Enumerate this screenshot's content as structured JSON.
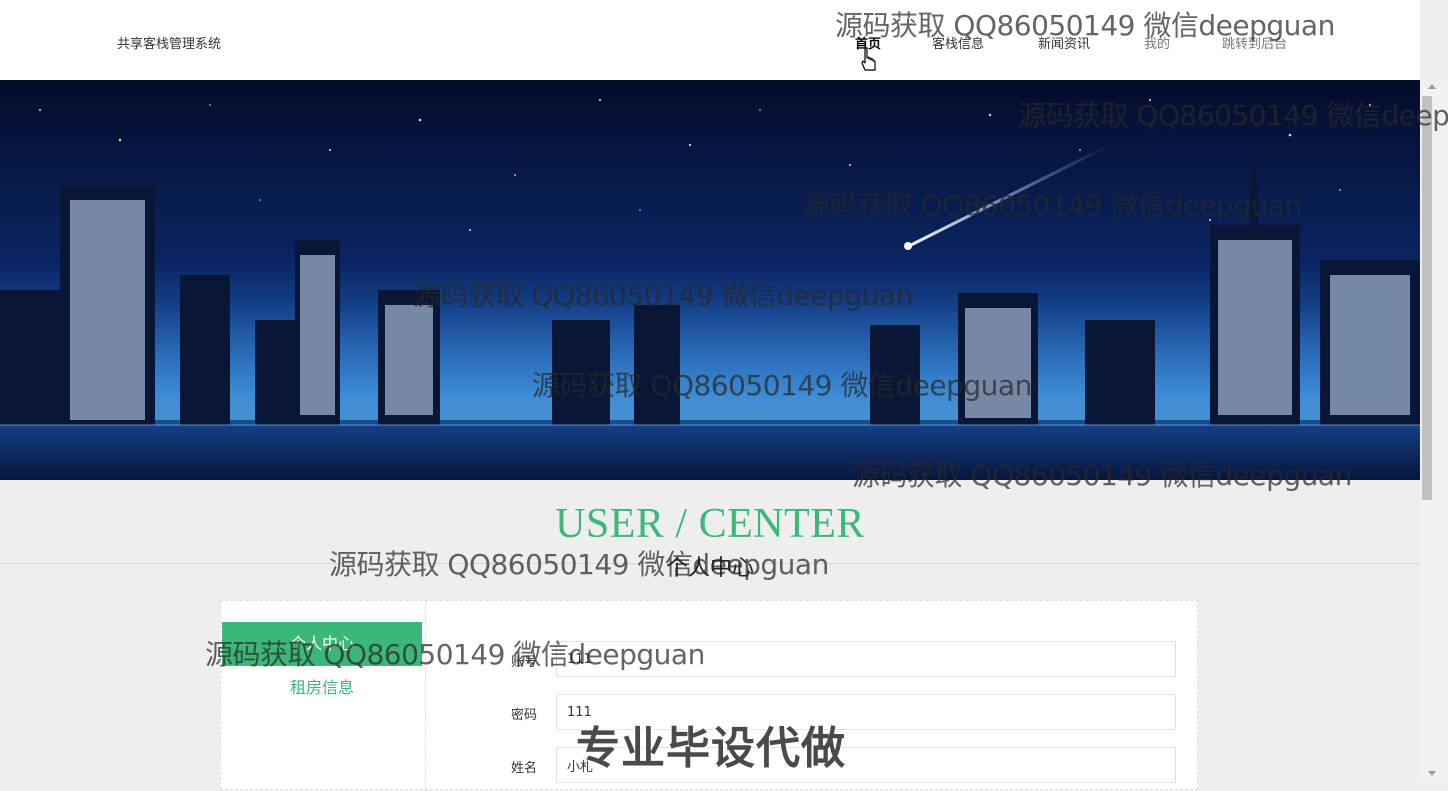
{
  "header": {
    "brand": "共享客栈管理系统",
    "nav": [
      {
        "label": "首页",
        "active": true
      },
      {
        "label": "客栈信息"
      },
      {
        "label": "新闻资讯"
      },
      {
        "label": "我的"
      },
      {
        "label": "跳转到后台"
      }
    ]
  },
  "section": {
    "title_en": "USER / CENTER",
    "title_cn": "个人中心"
  },
  "sidebar": {
    "items": [
      {
        "label": "个人中心",
        "active": true
      },
      {
        "label": "租房信息"
      }
    ]
  },
  "form": {
    "fields": [
      {
        "label": "账号",
        "value": "111"
      },
      {
        "label": "密码",
        "value": "111"
      },
      {
        "label": "姓名",
        "value": "小札"
      }
    ]
  },
  "watermark": {
    "text": "源码获取 QQ86050149 微信deepguan",
    "stamp": "专业毕设代做"
  },
  "colors": {
    "accent": "#3bb878",
    "banner_sky": "#0a1a4a"
  }
}
